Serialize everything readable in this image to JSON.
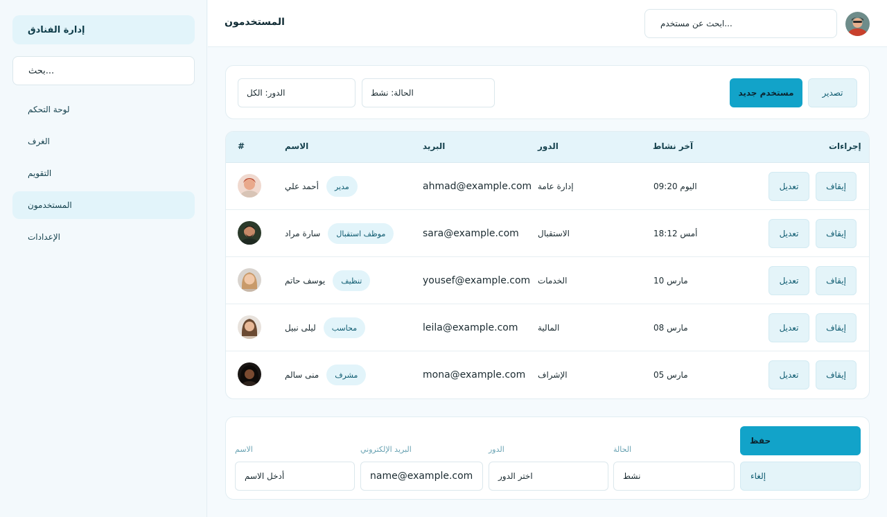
{
  "sidebar": {
    "brand": "إدارة الفنادق",
    "search_placeholder": "بحث...",
    "items": [
      {
        "label": "لوحة التحكم"
      },
      {
        "label": "الغرف"
      },
      {
        "label": "التقويم"
      },
      {
        "label": "المستخدمون"
      },
      {
        "label": "الإعدادات"
      }
    ]
  },
  "header": {
    "title": "المستخدمون",
    "search_placeholder": "ابحث عن مستخدم..."
  },
  "toolbar": {
    "role_filter": "الدور: الكل",
    "status_filter": "الحالة: نشط",
    "new_user_label": "مستخدم جديد",
    "export_label": "تصدير"
  },
  "table": {
    "headers": {
      "index": "#",
      "name": "الاسم",
      "email": "البريد",
      "role": "الدور",
      "last_active": "آخر نشاط",
      "actions": "إجراءات"
    },
    "rows": [
      {
        "name": "أحمد علي",
        "badge": "مدير",
        "email": "ahmad@example.com",
        "role": "إدارة عامة",
        "last_active": "اليوم 09:20",
        "edit": "تعديل",
        "suspend": "إيقاف"
      },
      {
        "name": "سارة مراد",
        "badge": "موظف استقبال",
        "email": "sara@example.com",
        "role": "الاستقبال",
        "last_active": "أمس 18:12",
        "edit": "تعديل",
        "suspend": "إيقاف"
      },
      {
        "name": "يوسف حاتم",
        "badge": "تنظيف",
        "email": "yousef@example.com",
        "role": "الخدمات",
        "last_active": "مارس 10",
        "edit": "تعديل",
        "suspend": "إيقاف"
      },
      {
        "name": "ليلى نبيل",
        "badge": "محاسب",
        "email": "leila@example.com",
        "role": "المالية",
        "last_active": "مارس 08",
        "edit": "تعديل",
        "suspend": "إيقاف"
      },
      {
        "name": "منى سالم",
        "badge": "مشرف",
        "email": "mona@example.com",
        "role": "الإشراف",
        "last_active": "مارس 05",
        "edit": "تعديل",
        "suspend": "إيقاف"
      }
    ]
  },
  "form": {
    "name_label": "الاسم",
    "name_placeholder": "أدخل الاسم",
    "email_label": "البريد الإلكتروني",
    "email_placeholder": "name@example.com",
    "role_label": "الدور",
    "role_placeholder": "اختر الدور",
    "status_label": "الحالة",
    "status_value": "نشط",
    "save_label": "حفظ",
    "cancel_label": "إلغاء"
  },
  "colors": {
    "accent": "#12a3c9",
    "accent_soft": "#e4f4f9",
    "background": "#f5fafd"
  }
}
